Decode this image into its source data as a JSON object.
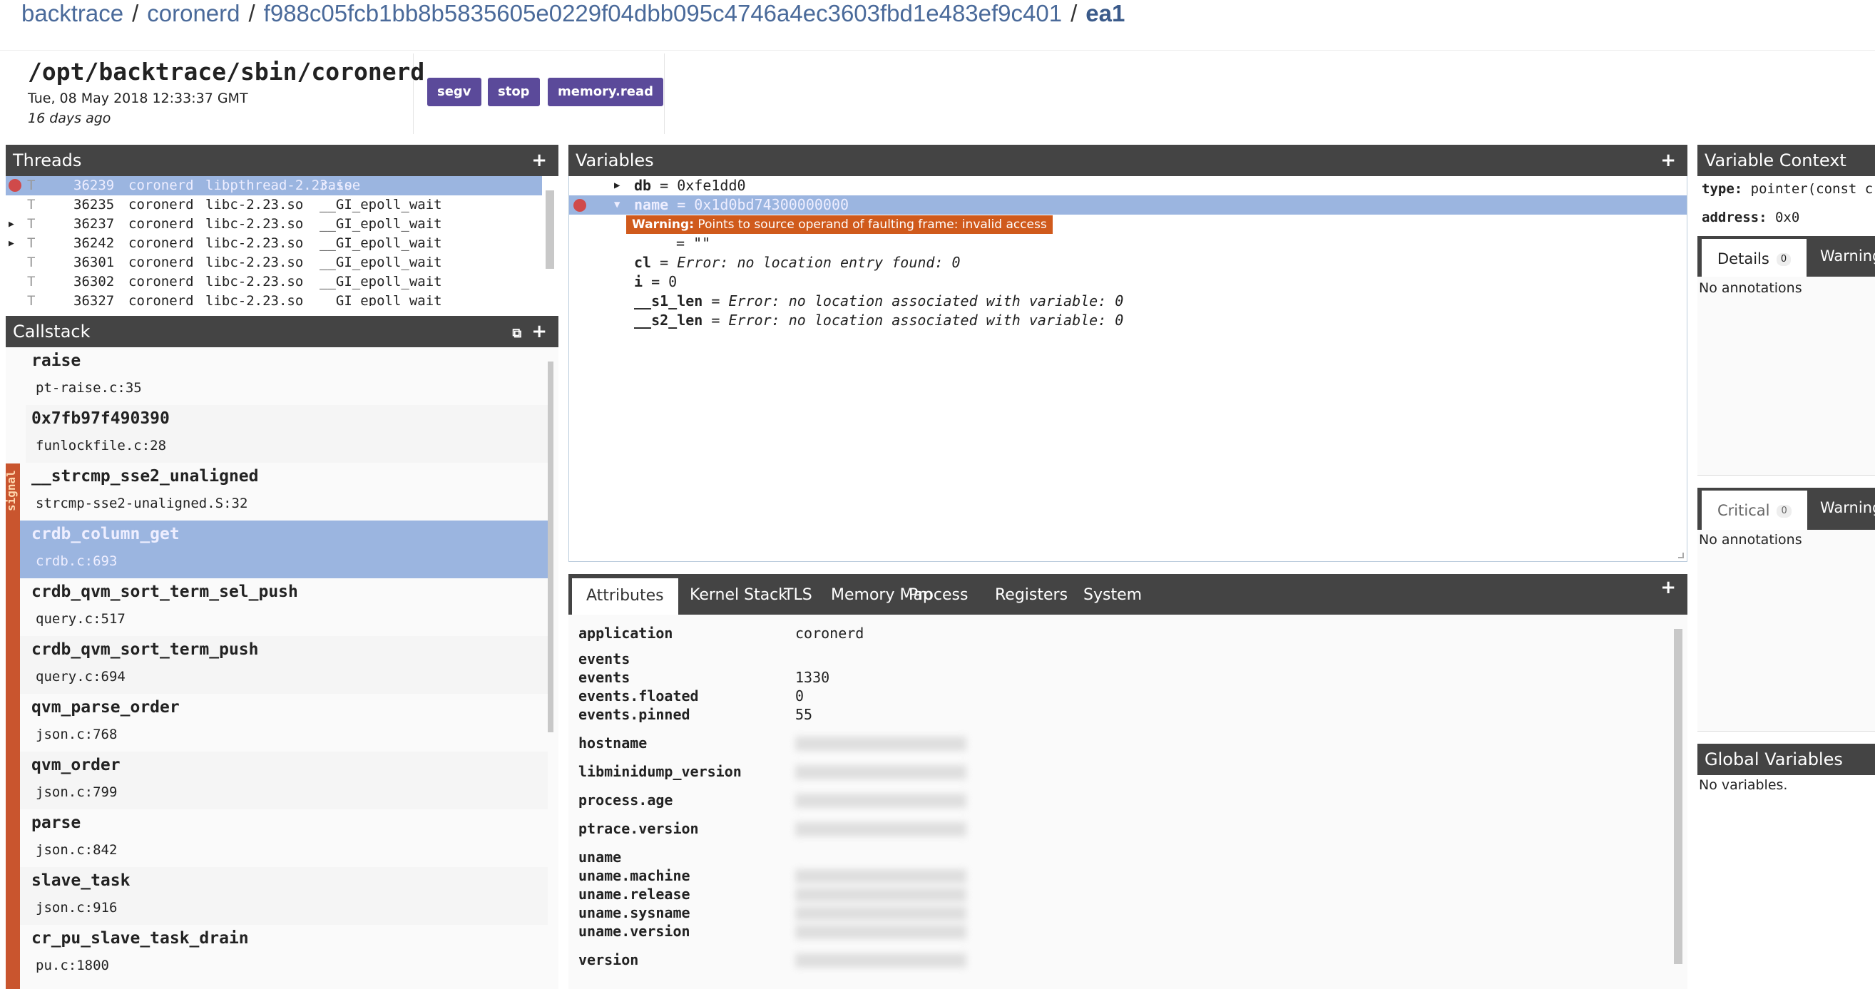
{
  "breadcrumb": [
    "backtrace",
    "coronerd",
    "f988c05fcb1bb8b5835605e0229f04dbb095c4746a4ec3603fbd1e483ef9c401",
    "ea1"
  ],
  "header": {
    "title": "/opt/backtrace/sbin/coronerd",
    "date": "Tue, 08 May 2018 12:33:37 GMT",
    "ago": "16 days ago",
    "badges": [
      "segv",
      "stop",
      "memory.read"
    ]
  },
  "threads": {
    "title": "Threads",
    "rows": [
      {
        "t": "T",
        "tid": "36239",
        "proc": "coronerd",
        "lib": "libpthread-2.23.so",
        "fn": "raise",
        "selected": true,
        "fault": true,
        "expand": false
      },
      {
        "t": "T",
        "tid": "36235",
        "proc": "coronerd",
        "lib": "libc-2.23.so",
        "fn": "__GI_epoll_wait",
        "expand": false
      },
      {
        "t": "T",
        "tid": "36237",
        "proc": "coronerd",
        "lib": "libc-2.23.so",
        "fn": "__GI_epoll_wait",
        "expand": true
      },
      {
        "t": "T",
        "tid": "36242",
        "proc": "coronerd",
        "lib": "libc-2.23.so",
        "fn": "__GI_epoll_wait",
        "expand": true
      },
      {
        "t": "T",
        "tid": "36301",
        "proc": "coronerd",
        "lib": "libc-2.23.so",
        "fn": "__GI_epoll_wait",
        "expand": false
      },
      {
        "t": "T",
        "tid": "36302",
        "proc": "coronerd",
        "lib": "libc-2.23.so",
        "fn": "__GI_epoll_wait",
        "expand": false
      },
      {
        "t": "T",
        "tid": "36327",
        "proc": "coronerd",
        "lib": "libc-2.23.so",
        "fn": "__GI_epoll_wait",
        "expand": false
      }
    ]
  },
  "callstack": {
    "title": "Callstack",
    "signal_label": "signal",
    "frames": [
      {
        "fn": "raise",
        "file": "pt-raise.c:35"
      },
      {
        "fn": "0x7fb97f490390",
        "file": "funlockfile.c:28"
      },
      {
        "fn": "__strcmp_sse2_unaligned",
        "file": "strcmp-sse2-unaligned.S:32"
      },
      {
        "fn": "crdb_column_get",
        "file": "crdb.c:693",
        "selected": true
      },
      {
        "fn": "crdb_qvm_sort_term_sel_push",
        "file": "query.c:517"
      },
      {
        "fn": "crdb_qvm_sort_term_push",
        "file": "query.c:694"
      },
      {
        "fn": "qvm_parse_order",
        "file": "json.c:768"
      },
      {
        "fn": "qvm_order",
        "file": "json.c:799"
      },
      {
        "fn": "parse",
        "file": "json.c:842"
      },
      {
        "fn": "slave_task",
        "file": "json.c:916"
      },
      {
        "fn": "cr_pu_slave_task_drain",
        "file": "pu.c:1800"
      }
    ]
  },
  "variables": {
    "title": "Variables",
    "rows": [
      {
        "name": "db",
        "eq": " = ",
        "value": "0xfe1dd0",
        "arrow": "▶"
      },
      {
        "name": "name",
        "eq": " = ",
        "value": "0x1d0bd74300000000",
        "arrow": "▼",
        "selected": true
      },
      {
        "name": "",
        "eq": "= ",
        "value": "\"\""
      },
      {
        "name": "cl",
        "eq": " = ",
        "error": "Error: no location entry found: 0"
      },
      {
        "name": "i",
        "eq": " = ",
        "value": "0"
      },
      {
        "name": "__s1_len",
        "eq": " = ",
        "error": "Error: no location associated with variable: 0"
      },
      {
        "name": "__s2_len",
        "eq": " = ",
        "error": "Error: no location associated with variable: 0"
      }
    ],
    "warning_label": "Warning:",
    "warning_text": " Points to source operand of faulting frame: invalid access"
  },
  "attributes": {
    "tabs": [
      "Attributes",
      "Kernel Stack",
      "TLS",
      "Memory Map",
      "Process",
      "Registers",
      "System"
    ],
    "active": "Attributes",
    "rows": [
      {
        "k": "application",
        "v": "coronerd"
      },
      {
        "k": "events",
        "v": ""
      },
      {
        "k": "events",
        "v": "1330"
      },
      {
        "k": "events.floated",
        "v": "0"
      },
      {
        "k": "events.pinned",
        "v": "55"
      },
      {
        "k": "hostname",
        "blurred": true
      },
      {
        "k": "libminidump_version",
        "blurred": true
      },
      {
        "k": "process.age",
        "blurred": true
      },
      {
        "k": "ptrace.version",
        "blurred": true
      },
      {
        "k": "uname",
        "v": ""
      },
      {
        "k": "uname.machine",
        "blurred": true
      },
      {
        "k": "uname.release",
        "blurred": true
      },
      {
        "k": "uname.sysname",
        "blurred": true
      },
      {
        "k": "uname.version",
        "blurred": true
      },
      {
        "k": "version",
        "blurred": true
      }
    ]
  },
  "context": {
    "title": "Variable Context",
    "type_label": "type:",
    "type_value": "pointer(const c",
    "address_label": "address:",
    "address_value": "0x0",
    "tabs1": [
      {
        "label": "Details",
        "count": "0"
      },
      {
        "label": "Warnings"
      }
    ],
    "empty1": "No annotations",
    "tabs2": [
      {
        "label": "Critical",
        "count": "0"
      },
      {
        "label": "Warning"
      }
    ],
    "empty2": "No annotations"
  },
  "globals": {
    "title": "Global Variables",
    "empty": "No variables."
  },
  "colors": {
    "header": "#444444",
    "selection": "#9bb5e0",
    "badge": "#5b4a9a",
    "warning": "#d05a1c",
    "signal": "#c9552e"
  }
}
